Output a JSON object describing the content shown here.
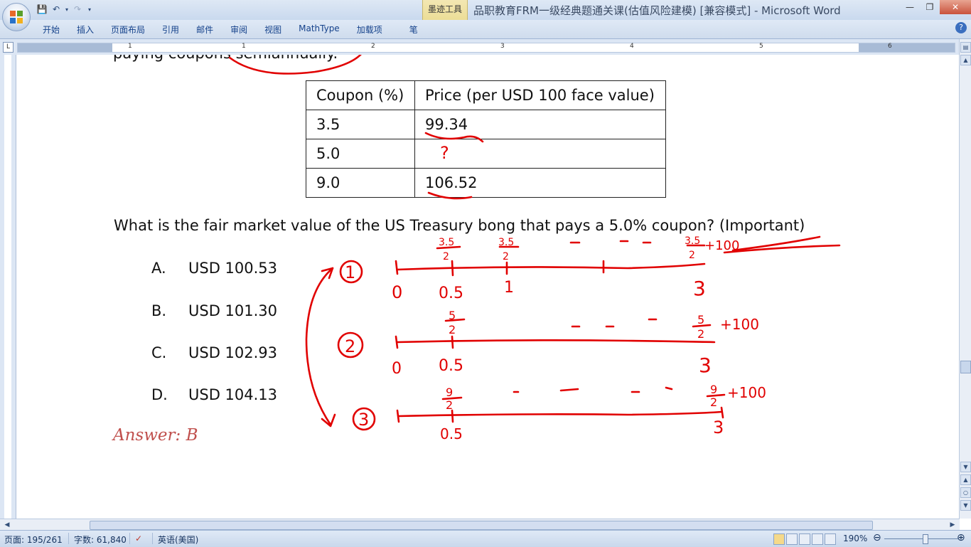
{
  "window": {
    "title": "品职教育FRM一级经典题通关课(估值风险建模) [兼容模式] - Microsoft Word",
    "context_tab": "墨迹工具"
  },
  "ribbon": {
    "tabs": [
      "开始",
      "插入",
      "页面布局",
      "引用",
      "邮件",
      "审阅",
      "视图",
      "MathType",
      "加载项",
      "笔"
    ]
  },
  "ruler": {
    "numbers": [
      "1",
      "1",
      "2",
      "3",
      "4",
      "5",
      "6"
    ]
  },
  "document": {
    "top_text": "paying coupons semiannually.",
    "table": {
      "headers": [
        "Coupon (%)",
        "Price (per USD 100 face value)"
      ],
      "rows": [
        [
          "3.5",
          "99.34"
        ],
        [
          "5.0",
          ""
        ],
        [
          "9.0",
          "106.52"
        ]
      ]
    },
    "question": "What is the fair market value of the US Treasury bong that pays a 5.0% coupon? (Important)",
    "options": [
      {
        "letter": "A.",
        "text": "USD 100.53"
      },
      {
        "letter": "B.",
        "text": "USD 101.30"
      },
      {
        "letter": "C.",
        "text": "USD 102.93"
      },
      {
        "letter": "D.",
        "text": "USD 104.13"
      }
    ],
    "answer": "Answer: B"
  },
  "ink": {
    "question_mark": "?",
    "circle_labels": [
      "1",
      "2",
      "3"
    ],
    "axis_labels": [
      "0",
      "0.5",
      "1",
      "3"
    ],
    "fractions": [
      "3.5",
      "2",
      "5",
      "9"
    ],
    "plus_100": "+100",
    "color": "#e10000"
  },
  "statusbar": {
    "page": "页面: 195/261",
    "words": "字数: 61,840",
    "language": "英语(美国)",
    "zoom": "190%"
  },
  "colors": {
    "ribbon_bg": "#dfe9f6",
    "answer": "#c0504d",
    "ink": "#e10000"
  }
}
